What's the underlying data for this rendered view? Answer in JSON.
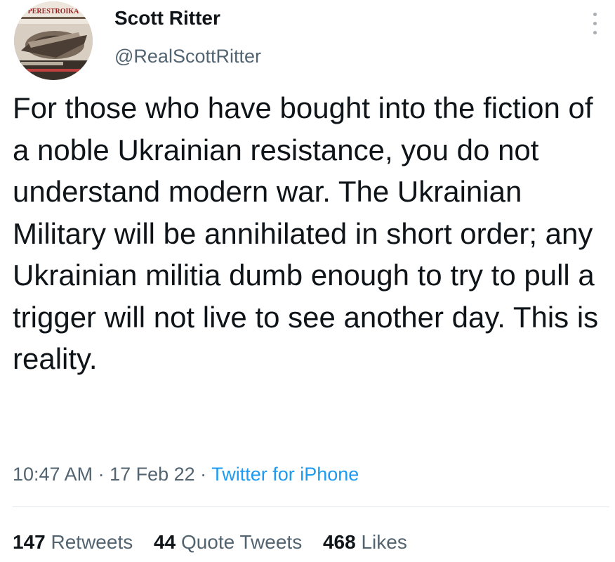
{
  "author": {
    "name": "Scott Ritter",
    "handle": "@RealScottRitter",
    "avatar_label": "PERESTROIKA"
  },
  "tweet": {
    "text": "For those who have bought into the fiction of a noble Ukrainian resistance, you do not understand modern war. The Ukrainian Military will be annihilated in short order; any Ukrainian militia dumb enough to try to pull a trigger will not live to see another day. This is reality."
  },
  "meta": {
    "time": "10:47 AM",
    "separator": " · ",
    "date": "17 Feb 22",
    "source": "Twitter for iPhone"
  },
  "stats": {
    "retweets_count": "147",
    "retweets_label": "Retweets",
    "quotes_count": "44",
    "quotes_label": "Quote Tweets",
    "likes_count": "468",
    "likes_label": "Likes"
  },
  "colors": {
    "text": "#0f1419",
    "secondary": "#536471",
    "link": "#1d9bf0",
    "divider": "#e1e6ea"
  },
  "icons": {
    "more": "more-vertical-icon"
  }
}
